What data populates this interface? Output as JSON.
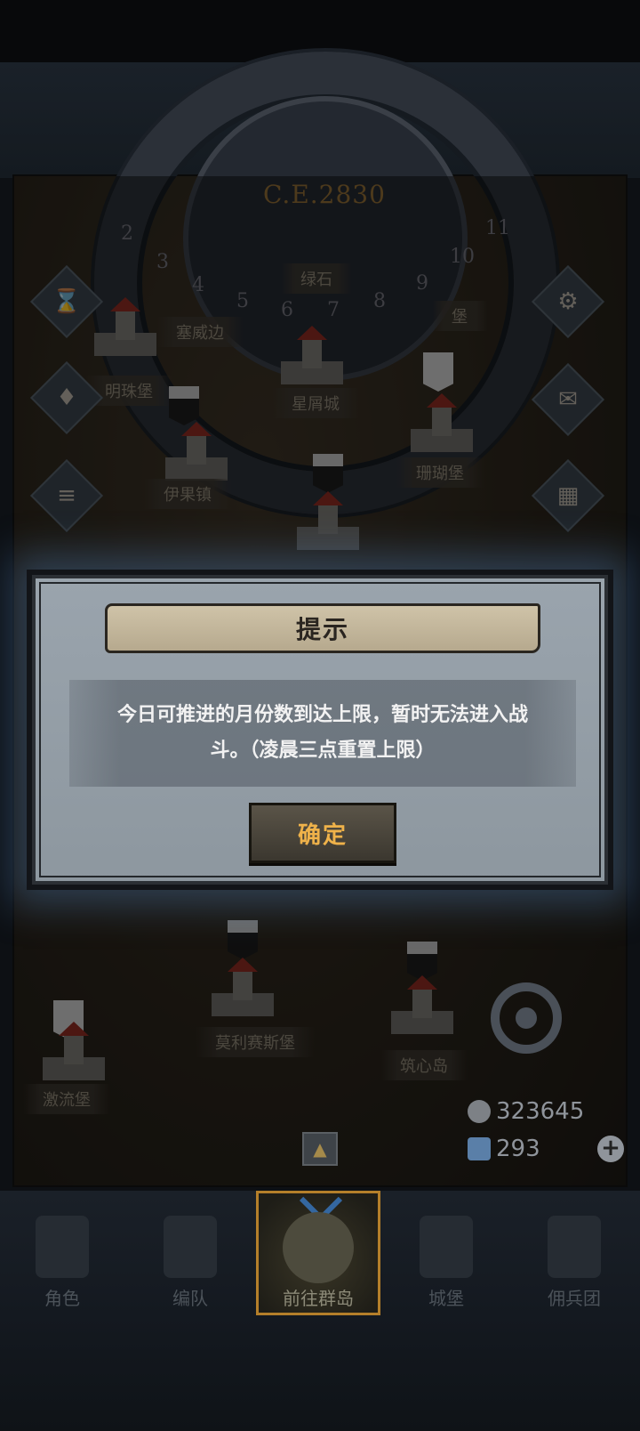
{
  "calendar": {
    "era": "C.E.2830",
    "months": [
      "2",
      "3",
      "4",
      "5",
      "6",
      "7",
      "8",
      "9",
      "10",
      "11"
    ]
  },
  "map": {
    "towns": [
      {
        "id": "emerald",
        "name": "绿石"
      },
      {
        "id": "saiwei",
        "name": "塞威边"
      },
      {
        "id": "xx-fort",
        "name": "堡"
      },
      {
        "id": "mingzhu",
        "name": "明珠堡"
      },
      {
        "id": "xingxie",
        "name": "星屑城"
      },
      {
        "id": "shanhu",
        "name": "珊瑚堡"
      },
      {
        "id": "yiguo",
        "name": "伊果镇"
      },
      {
        "id": "molisaisi",
        "name": "莫利赛斯堡"
      },
      {
        "id": "zhuxin",
        "name": "筑心岛"
      },
      {
        "id": "jiliu",
        "name": "激流堡"
      }
    ]
  },
  "resources": {
    "gold": "323645",
    "crystal": "293"
  },
  "bottom_nav": {
    "items": [
      {
        "label": "角色"
      },
      {
        "label": "编队"
      },
      {
        "label": "前往群岛"
      },
      {
        "label": "城堡"
      },
      {
        "label": "佣兵团"
      }
    ]
  },
  "dialog": {
    "title": "提示",
    "message": "今日可推进的月份数到达上限，暂时无法进入战斗。（凌晨三点重置上限）",
    "confirm_label": "确定"
  },
  "colors": {
    "accent_gold": "#efb24a",
    "active_tab_border": "#b47f2a",
    "chevron_blue": "#3467a0"
  }
}
